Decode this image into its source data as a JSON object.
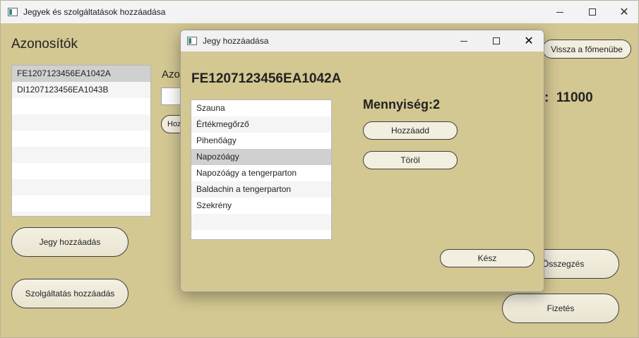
{
  "main": {
    "title": "Jegyek és szolgáltatások hozzáadása",
    "heading": "Azonosítók",
    "id_list": [
      "FE1207123456EA1042A",
      "DI1207123456EA1043B",
      "",
      "",
      "",
      "",
      "",
      "",
      "",
      ""
    ],
    "selected_index": 0,
    "partial_label": "Azo",
    "partial_button": "Hoz",
    "back_button": "Vissza a főmenübe",
    "total_value": ":  11000",
    "add_ticket_button": "Jegy hozzáadás",
    "add_service_button": "Szolgáltatás hozzáadás",
    "summary_button": "Összegzés",
    "pay_button": "Fizetés"
  },
  "dialog": {
    "title": "Jegy hozzáadása",
    "ticket_id": "FE1207123456EA1042A",
    "services": [
      "Szauna",
      "Értékmegőrző",
      "Pihenőágy",
      "Napozóágy",
      "Napozóágy a tengerparton",
      "Baldachin a tengerparton",
      "Szekrény",
      "",
      ""
    ],
    "selected_index": 3,
    "quantity": "Mennyiség:2",
    "add_button": "Hozzáadd",
    "remove_button": "Töröl",
    "done_button": "Kész"
  },
  "colors": {
    "background": "#d3c792",
    "titlebar": "#f3f3f3",
    "button_fill": "#f2eee0",
    "selection": "#d0d0d0"
  }
}
